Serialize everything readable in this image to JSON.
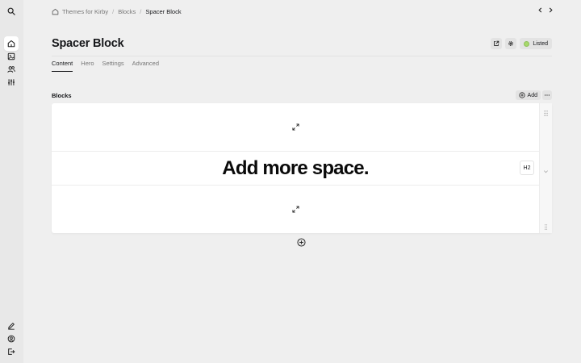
{
  "sidebar": {
    "top_items": [
      {
        "icon": "search-icon"
      }
    ],
    "nav_items": [
      {
        "icon": "home-icon",
        "active": true
      },
      {
        "icon": "images-icon"
      },
      {
        "icon": "users-icon"
      },
      {
        "icon": "settings-sliders-icon"
      }
    ],
    "bottom_items": [
      {
        "icon": "pencil-icon"
      },
      {
        "icon": "account-icon"
      },
      {
        "icon": "logout-icon"
      }
    ]
  },
  "breadcrumb": {
    "items": [
      "Themes for Kirby",
      "Blocks",
      "Spacer Block"
    ]
  },
  "page": {
    "title": "Spacer Block",
    "status_label": "Listed",
    "status_color": "#a7d96c"
  },
  "tabs": [
    "Content",
    "Hero",
    "Settings",
    "Advanced"
  ],
  "blocks_field": {
    "label": "Blocks",
    "add_label": "Add",
    "heading_text": "Add more space.",
    "heading_level": "H2"
  },
  "colors": {
    "background": "#efefef",
    "sidebar": "#e8e8e8",
    "card": "#ffffff",
    "text": "#16171a",
    "muted": "#777777"
  }
}
